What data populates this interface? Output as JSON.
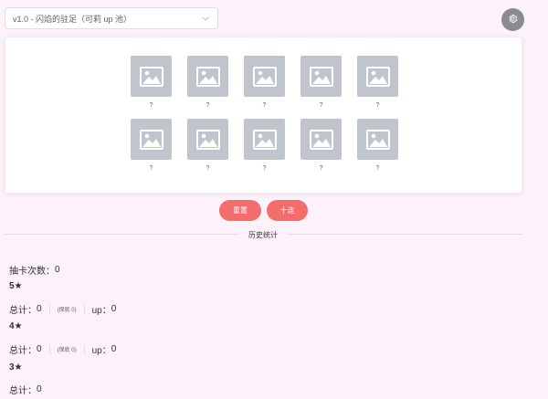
{
  "pool_select": {
    "value": "v1.0 - 闪焰的驻足（可莉 up 池）"
  },
  "icons": {
    "settings": "gear-icon",
    "chevron": "chevron-down-icon",
    "placeholder": "image-placeholder-icon"
  },
  "colors": {
    "accent": "#f56c6c",
    "placeholder": "#c0c4cc",
    "background": "#fdf2fa"
  },
  "results": {
    "slots": [
      {
        "label": "?"
      },
      {
        "label": "?"
      },
      {
        "label": "?"
      },
      {
        "label": "?"
      },
      {
        "label": "?"
      },
      {
        "label": "?"
      },
      {
        "label": "?"
      },
      {
        "label": "?"
      },
      {
        "label": "?"
      },
      {
        "label": "?"
      }
    ]
  },
  "actions": {
    "reset_label": "重置",
    "ten_pull_label": "十连"
  },
  "history": {
    "title": "历史统计",
    "pull_count_label": "抽卡次数：",
    "pull_count": "0",
    "five_star": {
      "heading": "5★",
      "total_label": "总计：",
      "total": "0",
      "pity_text": "(保底 0)",
      "up_label": "up：",
      "up": "0"
    },
    "four_star": {
      "heading": "4★",
      "total_label": "总计：",
      "total": "0",
      "pity_text": "(保底 0)",
      "up_label": "up：",
      "up": "0"
    },
    "three_star": {
      "heading": "3★",
      "total_label": "总计：",
      "total": "0"
    }
  }
}
